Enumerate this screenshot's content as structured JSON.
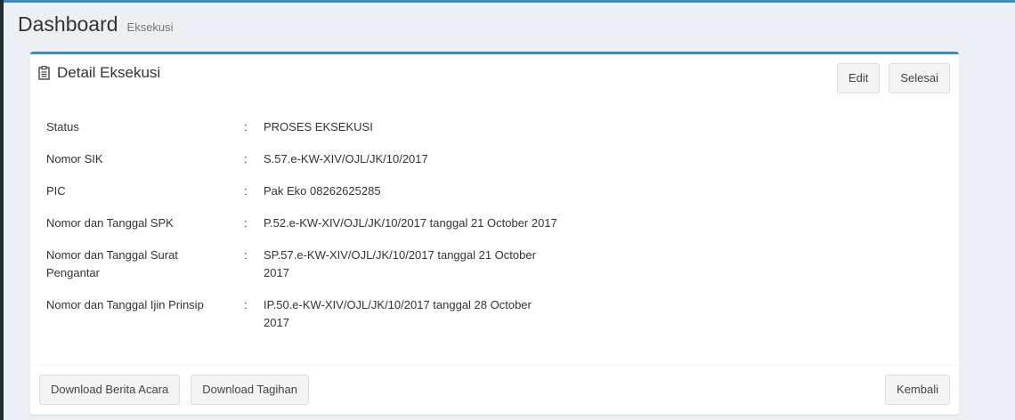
{
  "header": {
    "title": "Dashboard",
    "subtitle": "Eksekusi"
  },
  "box": {
    "title": "Detail Eksekusi",
    "title_icon": "clipboard-icon",
    "edit_label": "Edit",
    "finish_label": "Selesai"
  },
  "details": [
    {
      "label": "Status",
      "colon": ":",
      "value": "PROSES EKSEKUSI"
    },
    {
      "label": "Nomor SIK",
      "colon": ":",
      "value": "S.57.e-KW-XIV/OJL/JK/10/2017"
    },
    {
      "label": "PIC",
      "colon": ":",
      "value": "Pak Eko 08262625285"
    },
    {
      "label": "Nomor dan Tanggal SPK",
      "colon": ":",
      "value": "P.52.e-KW-XIV/OJL/JK/10/2017 tanggal 21 October 2017"
    },
    {
      "label": "Nomor dan Tanggal Surat Pengantar",
      "colon": ":",
      "value": "SP.57.e-KW-XIV/OJL/JK/10/2017 tanggal 21 October 2017"
    },
    {
      "label": "Nomor dan Tanggal Ijin Prinsip",
      "colon": ":",
      "value": "IP.50.e-KW-XIV/OJL/JK/10/2017 tanggal 28 October 2017"
    }
  ],
  "footer": {
    "download_ba_label": "Download Berita Acara",
    "download_tagihan_label": "Download Tagihan",
    "back_label": "Kembali"
  },
  "colors": {
    "accent": "#3c8dbc",
    "background": "#ecf0f5",
    "sidebar": "#222d32"
  }
}
